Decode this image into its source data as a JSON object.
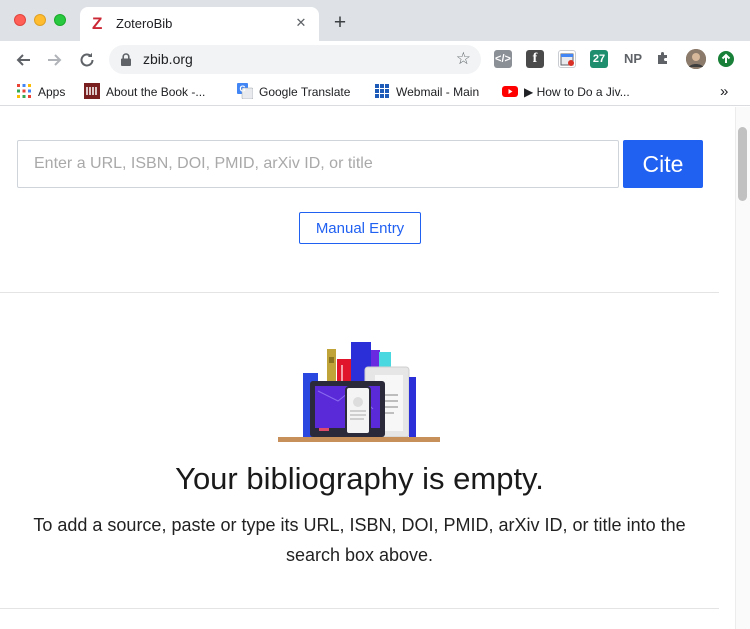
{
  "browser": {
    "tab": {
      "title": "ZoteroBib",
      "favicon": "Z",
      "close": "✕"
    },
    "new_tab": "+",
    "url": "zbib.org",
    "extensions": [
      "code-icon",
      "facebook-icon",
      "calendar-icon",
      "27",
      "NP",
      "puzzle-icon",
      "avatar",
      "update-icon"
    ],
    "ext_labels": {
      "twentyseven": "27",
      "np": "NP"
    }
  },
  "bookmarks": [
    {
      "label": "Apps"
    },
    {
      "label": "About the Book -..."
    },
    {
      "label": "Google Translate"
    },
    {
      "label": "Webmail - Main"
    },
    {
      "label": "▶ How to Do a Jiv..."
    }
  ],
  "bookmarks_overflow": "»",
  "page": {
    "search_placeholder": "Enter a URL, ISBN, DOI, PMID, arXiv ID, or title",
    "cite_label": "Cite",
    "manual_entry_label": "Manual Entry",
    "empty_title": "Your bibliography is empty.",
    "empty_description": "To add a source, paste or type its URL, ISBN, DOI, PMID, arXiv ID, or title into the search box above."
  },
  "colors": {
    "accent": "#2161f2",
    "tab_strip": "#dee1e6"
  }
}
